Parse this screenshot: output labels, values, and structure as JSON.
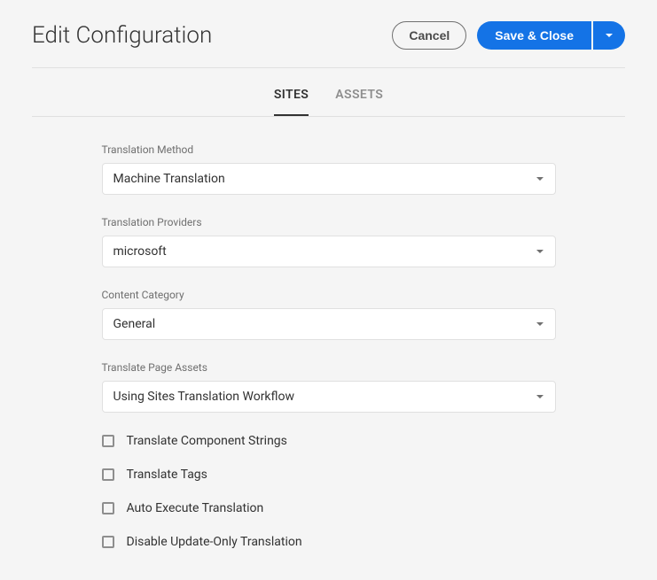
{
  "header": {
    "title": "Edit Configuration",
    "cancel": "Cancel",
    "save": "Save & Close"
  },
  "tabs": {
    "sites": "SITES",
    "assets": "ASSETS"
  },
  "fields": {
    "translationMethod": {
      "label": "Translation Method",
      "value": "Machine Translation"
    },
    "translationProviders": {
      "label": "Translation Providers",
      "value": "microsoft"
    },
    "contentCategory": {
      "label": "Content Category",
      "value": "General"
    },
    "translatePageAssets": {
      "label": "Translate Page Assets",
      "value": "Using Sites Translation Workflow"
    }
  },
  "checkboxes": {
    "componentStrings": "Translate Component Strings",
    "translateTags": "Translate Tags",
    "autoExecute": "Auto Execute Translation",
    "disableUpdateOnly": "Disable Update-Only Translation"
  }
}
